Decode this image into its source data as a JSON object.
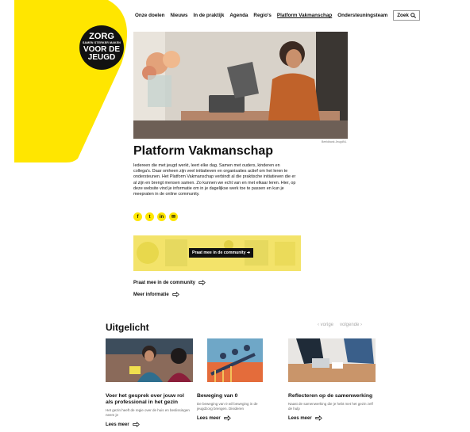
{
  "logo": {
    "line1": "ZORG",
    "line2": "SAMEN STERKER MAKEN",
    "line3": "VOOR DE",
    "line4": "JEUGD"
  },
  "nav": {
    "items": [
      "Onze doelen",
      "Nieuws",
      "In de praktijk",
      "Agenda",
      "Regio's",
      "Platform Vakmanschap",
      "Ondersteuningsteam"
    ],
    "active_index": 5,
    "search_label": "Zoek"
  },
  "hero": {
    "caption": "Beeldbank JeugdNL"
  },
  "page": {
    "title": "Platform Vakmanschap",
    "intro": "Iedereen die met jeugd werkt, leert elke dag. Samen met ouders, kinderen en collega's. Daar omheen zijn veel initiatieven en organisaties actief om het leren te ondersteunen. Het Platform Vakmanschap verbindt al die praktische initiatieven die er al zijn en brengt mensen samen. Zo kunnen we echt van en met elkaar leren. Hier, op deze website vind je informatie om in je dagelijkse werk toe te passen en kun je meepraten in de online community."
  },
  "social": [
    "facebook-icon",
    "twitter-icon",
    "linkedin-icon",
    "mail-icon"
  ],
  "banner": {
    "button_label": "Praat mee in de community"
  },
  "links": {
    "community": "Praat mee in de community",
    "info": "Meer informatie"
  },
  "featured": {
    "title": "Uitgelicht",
    "prev": "vorige",
    "next": "volgende",
    "cards": [
      {
        "title": "Voer het gesprek over jouw rol als professional in het gezin",
        "desc": "Het gezin heeft de regie over de huis en beslissingen neem je",
        "more": "Lees meer"
      },
      {
        "title": "Beweging van 0",
        "desc": "De beweging van 0 wil beweging in de jeugdzorg brengen. Divideren",
        "more": "Lees meer"
      },
      {
        "title": "Reflecteren op de samenwerking",
        "desc": "Naast de samenwerking die je hebt met het gezin zelf de hulp",
        "more": "Lees meer"
      }
    ]
  },
  "colors": {
    "accent": "#ffe600",
    "text": "#111111"
  }
}
